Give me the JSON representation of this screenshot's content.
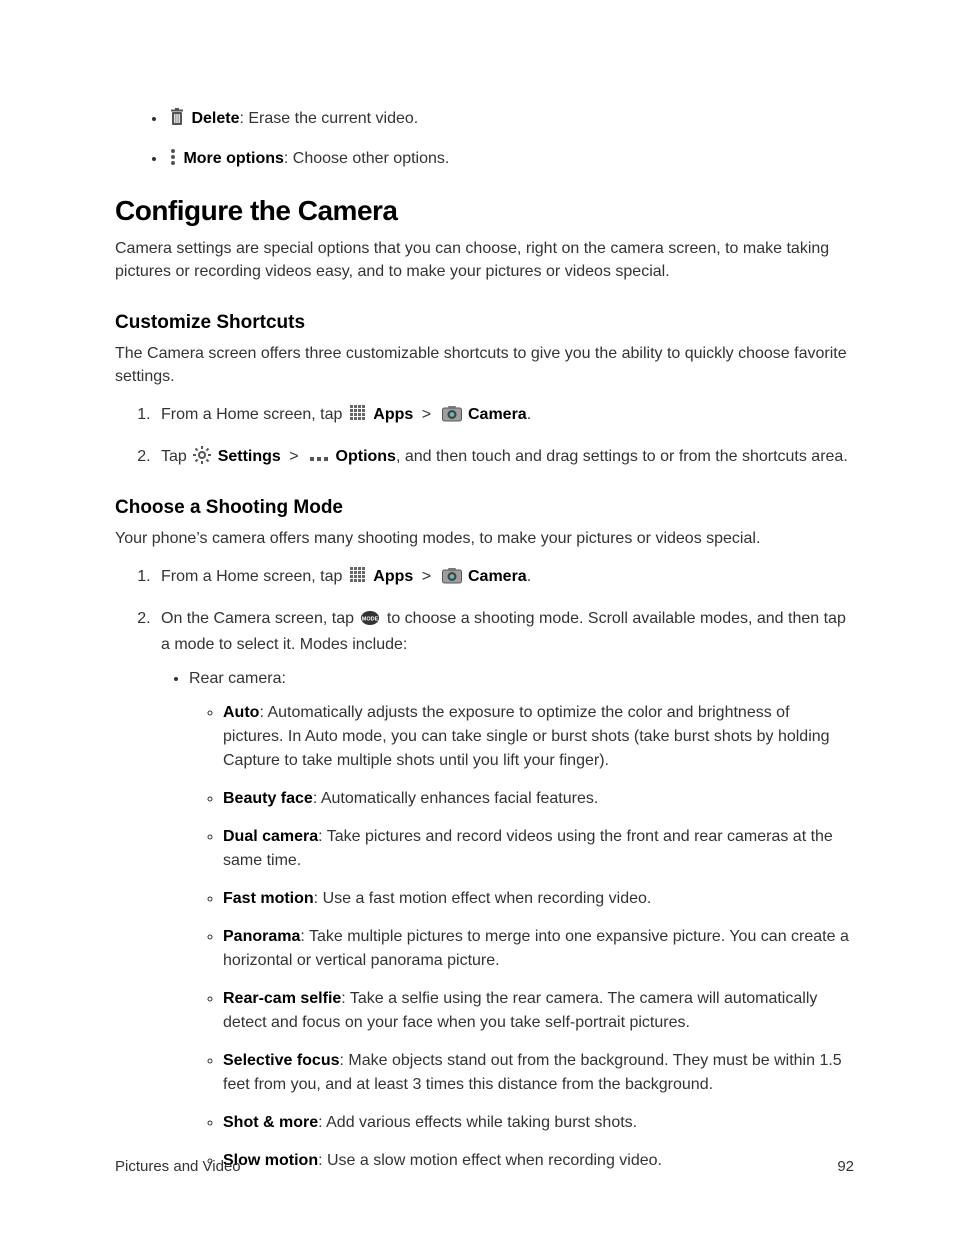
{
  "topItems": [
    {
      "label": "Delete",
      "desc": ": Erase the current video.",
      "icon": "trash-icon"
    },
    {
      "label": "More options",
      "desc": ": Choose other options.",
      "icon": "more-vert-icon"
    }
  ],
  "h1": "Configure the Camera",
  "introPara": "Camera settings are special options that you can choose, right on the camera screen, to make taking pictures or recording videos easy, and to make your pictures or videos special.",
  "customize": {
    "heading": "Customize Shortcuts",
    "para": "The Camera screen offers three customizable shortcuts to give you the ability to quickly choose favorite settings.",
    "step1a": "From a Home screen, tap ",
    "apps": "Apps",
    "sep": " > ",
    "camera": "Camera",
    "period": ".",
    "step2a": "Tap ",
    "settings": "Settings",
    "options": "Options",
    "step2b": ", and then touch and drag settings to or from the shortcuts area."
  },
  "shooting": {
    "heading": "Choose a Shooting Mode",
    "para": "Your phone’s camera offers many shooting modes, to make your pictures or videos special.",
    "step1a": "From a Home screen, tap ",
    "apps": "Apps",
    "sep": " > ",
    "camera": "Camera",
    "period": ".",
    "step2a": "On the Camera screen, tap ",
    "step2b": " to choose a shooting mode. Scroll available modes, and then tap a mode to select it. Modes include:",
    "rearLabel": "Rear camera:",
    "modes": [
      {
        "name": "Auto",
        "desc": ": Automatically adjusts the exposure to optimize the color and brightness of pictures. In Auto mode, you can take single or burst shots (take burst shots by holding Capture to take multiple shots until you lift your finger)."
      },
      {
        "name": "Beauty face",
        "desc": ": Automatically enhances facial features."
      },
      {
        "name": "Dual camera",
        "desc": ": Take pictures and record videos using the front and rear cameras at the same time."
      },
      {
        "name": "Fast motion",
        "desc": ": Use a fast motion effect when recording video."
      },
      {
        "name": "Panorama",
        "desc": ": Take multiple pictures to merge into one expansive picture. You can create a horizontal or vertical panorama picture."
      },
      {
        "name": "Rear-cam selfie",
        "desc": ": Take a selfie using the rear camera. The camera will automatically detect and focus on your face when you take self-portrait pictures."
      },
      {
        "name": "Selective focus",
        "desc": ": Make objects stand out from the background. They must be within 1.5 feet from you, and at least 3 times this distance from the background."
      },
      {
        "name": "Shot & more",
        "desc": ": Add various effects while taking burst shots."
      },
      {
        "name": "Slow motion",
        "desc": ": Use a slow motion effect when recording video."
      }
    ]
  },
  "footer": {
    "left": "Pictures and Video",
    "right": "92"
  }
}
